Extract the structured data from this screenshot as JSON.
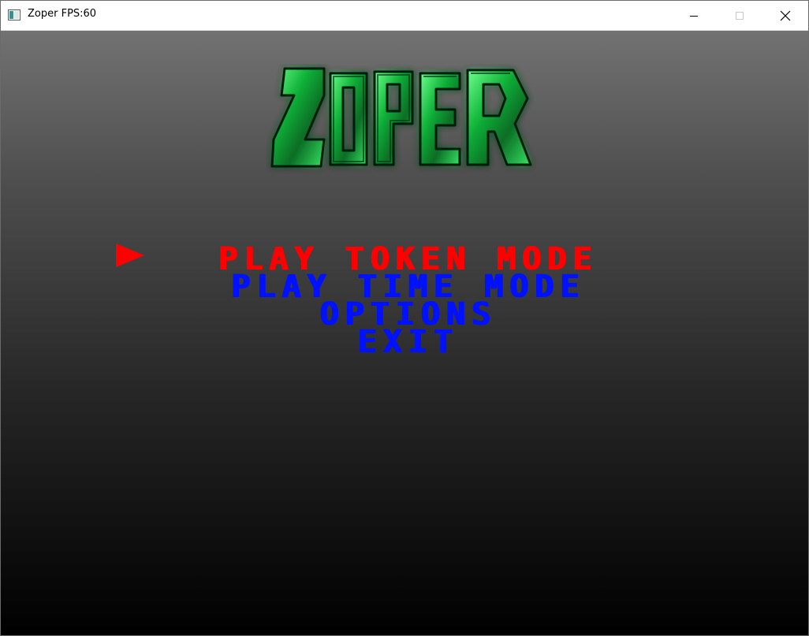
{
  "window": {
    "title": "Zoper FPS:60",
    "icon": "app-window-icon",
    "controls": {
      "minimize_icon": "minimize-icon",
      "maximize_icon": "maximize-icon",
      "close_icon": "close-icon"
    }
  },
  "game": {
    "logo_text": "ZOPER",
    "logo_color": "#1fd14a",
    "menu": {
      "items": [
        {
          "label": "PLAY TOKEN MODE",
          "selected": true
        },
        {
          "label": "PLAY TIME MODE",
          "selected": false
        },
        {
          "label": "OPTIONS",
          "selected": false
        },
        {
          "label": "EXIT",
          "selected": false
        }
      ],
      "selected_color": "#ff0000",
      "unselected_color": "#0011ff",
      "cursor_icon": "play-arrow-icon"
    },
    "background_gradient": [
      "#727272",
      "#000000"
    ]
  }
}
